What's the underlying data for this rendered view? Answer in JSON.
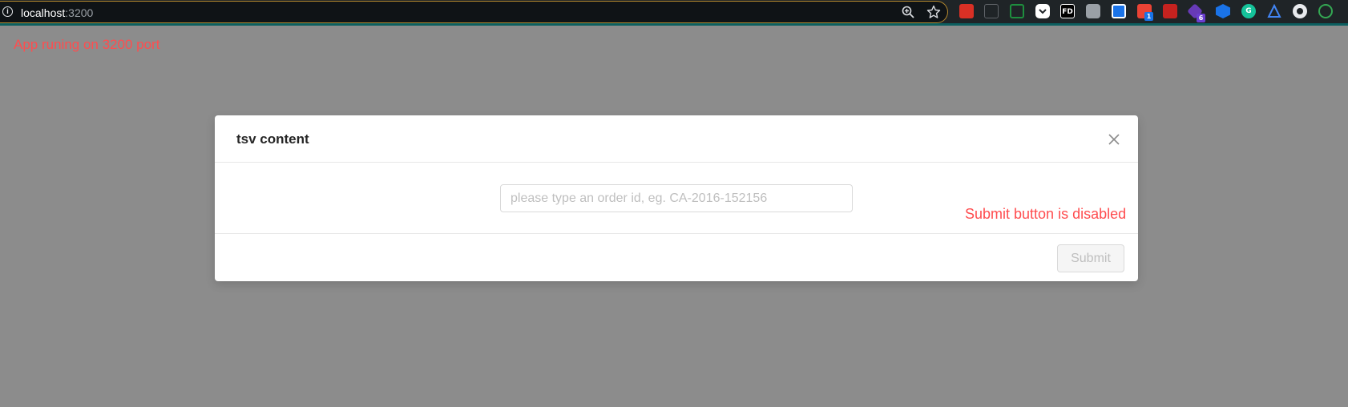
{
  "browser": {
    "url_host": "localhost",
    "url_port": ":3200",
    "address_bar_icons": [
      "zoom-icon",
      "bookmark-star-icon"
    ],
    "extensions": [
      {
        "name": "extension-red-icon",
        "color": "#d93025"
      },
      {
        "name": "extension-resize-icon",
        "color": "#5f6368"
      },
      {
        "name": "extension-screenshot-icon",
        "color": "#1e8e3e"
      },
      {
        "name": "pocket-icon",
        "color": "#ef4056"
      },
      {
        "name": "extension-fd-icon",
        "label": "FD",
        "color": "#000000"
      },
      {
        "name": "camera-icon",
        "color": "#9aa0a6"
      },
      {
        "name": "extension-blue-icon",
        "color": "#1a73e8"
      },
      {
        "name": "extension-badge-icon",
        "badge": "1",
        "color": "#ea4335"
      },
      {
        "name": "extension-youtube-icon",
        "color": "#c5221f"
      },
      {
        "name": "extension-purple-icon",
        "badge": "6",
        "color": "#673ab7"
      },
      {
        "name": "extension-cube-icon",
        "color": "#1a73e8"
      },
      {
        "name": "grammarly-icon",
        "color": "#15c39a"
      },
      {
        "name": "extension-triangle-icon",
        "color": "#4285f4"
      },
      {
        "name": "extension-globe-icon",
        "color": "#e8eaed"
      },
      {
        "name": "extension-green-icon",
        "color": "#34a853"
      }
    ]
  },
  "page_note": "App runing on 3200 port",
  "modal": {
    "title": "tsv content",
    "input": {
      "placeholder": "please type an order id, eg. CA-2016-152156",
      "value": ""
    },
    "annotation": "Submit button is disabled",
    "submit_label": "Submit",
    "submit_disabled": true
  },
  "colors": {
    "overlay": "#8c8c8c",
    "annotation": "#ff4d4f",
    "omnibox_border": "#b5892e",
    "toolbar_accent": "#0c5f60"
  }
}
